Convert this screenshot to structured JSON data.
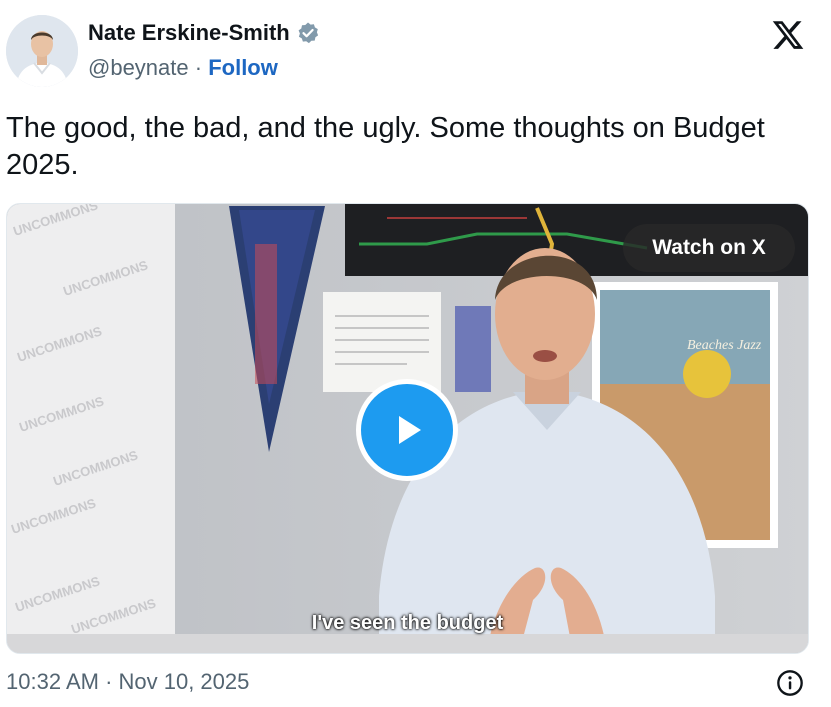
{
  "author": {
    "name": "Nate Erskine-Smith",
    "handle": "@beynate",
    "separator": "·",
    "follow_label": "Follow",
    "verified_icon": "verified-badge-icon"
  },
  "tweet": {
    "text": "The good, the bad, and the ugly. Some thoughts on Budget 2025.",
    "timestamp": "10:32 AM · Nov 10, 2025"
  },
  "media": {
    "watch_label": "Watch on X",
    "caption": "I've seen the budget",
    "play_icon": "play-icon",
    "watermark_word": "UNCOMMONS",
    "poster_word": "Beaches Jazz"
  },
  "colors": {
    "link": "#1d67c2",
    "play": "#1d9bf0",
    "text": "#0f1419",
    "muted": "#536471"
  }
}
